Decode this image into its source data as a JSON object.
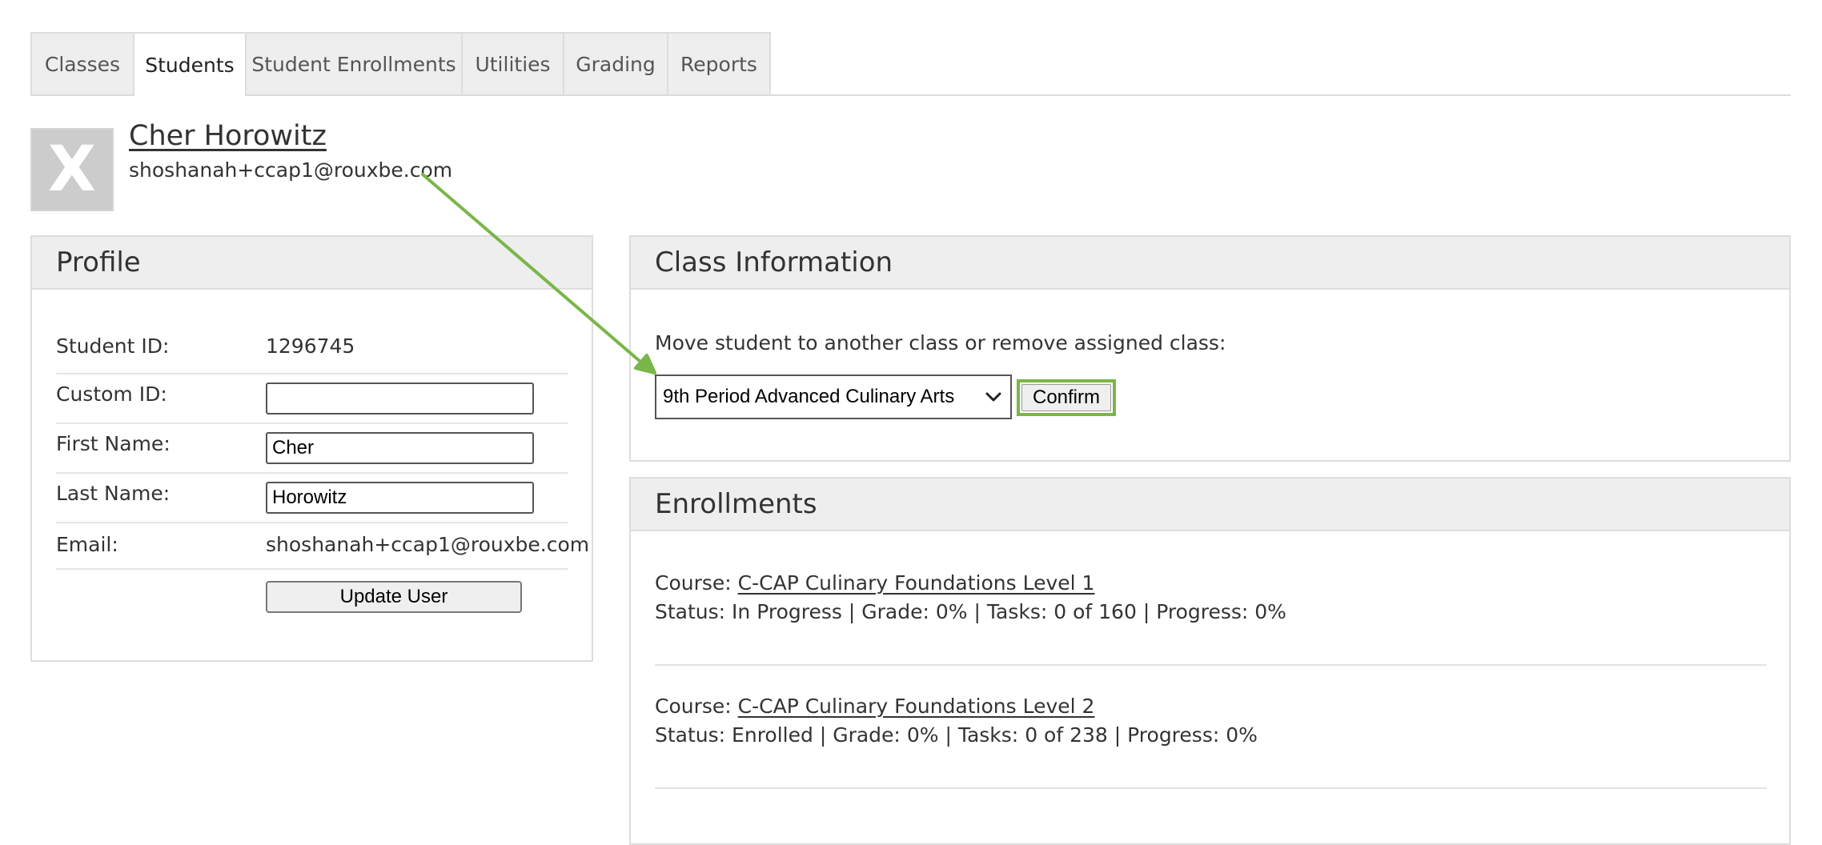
{
  "tabs": [
    {
      "label": "Classes",
      "active": false
    },
    {
      "label": "Students",
      "active": true
    },
    {
      "label": "Student Enrollments",
      "active": false
    },
    {
      "label": "Utilities",
      "active": false
    },
    {
      "label": "Grading",
      "active": false
    },
    {
      "label": "Reports",
      "active": false
    }
  ],
  "student": {
    "avatar_letter": "X",
    "name": "Cher Horowitz",
    "email": "shoshanah+ccap1@rouxbe.com"
  },
  "profile": {
    "title": "Profile",
    "student_id_label": "Student ID:",
    "student_id_value": "1296745",
    "custom_id_label": "Custom ID:",
    "custom_id_value": "",
    "first_name_label": "First Name:",
    "first_name_value": "Cher",
    "last_name_label": "Last Name:",
    "last_name_value": "Horowitz",
    "email_label": "Email:",
    "email_value": "shoshanah+ccap1@rouxbe.com",
    "update_button": "Update User"
  },
  "class_info": {
    "title": "Class Information",
    "move_text": "Move student to another class or remove assigned class:",
    "selected_class": "9th Period Advanced Culinary Arts",
    "confirm_button": "Confirm"
  },
  "enrollments": {
    "title": "Enrollments",
    "items": [
      {
        "course_label": "Course:",
        "course_name": "C-CAP Culinary Foundations Level 1",
        "status_label": "Status:",
        "status_value": "In Progress",
        "grade_label": "Grade:",
        "grade_value": "0%",
        "tasks_label": "Tasks:",
        "tasks_value": "0 of 160",
        "progress_label": "Progress:",
        "progress_value": "0%"
      },
      {
        "course_label": "Course:",
        "course_name": "C-CAP Culinary Foundations Level 2",
        "status_label": "Status:",
        "status_value": "Enrolled",
        "grade_label": "Grade:",
        "grade_value": "0%",
        "tasks_label": "Tasks:",
        "tasks_value": "0 of 238",
        "progress_label": "Progress:",
        "progress_value": "0%"
      }
    ]
  },
  "colors": {
    "annotation_green": "#7ab648",
    "panel_header_bg": "#eeeeee",
    "tab_bg": "#eeeeee"
  }
}
